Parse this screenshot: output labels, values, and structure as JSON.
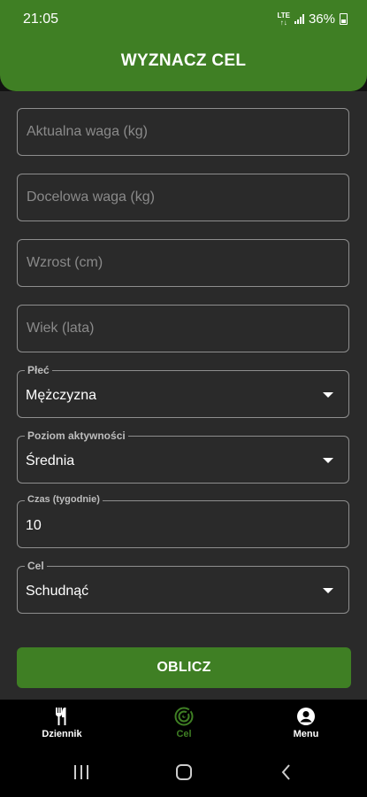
{
  "status_bar": {
    "time": "21:05",
    "battery": "36%",
    "network": "LTE"
  },
  "header": {
    "title": "WYZNACZ CEL"
  },
  "form": {
    "current_weight": {
      "placeholder": "Aktualna waga (kg)",
      "value": ""
    },
    "target_weight": {
      "placeholder": "Docelowa waga (kg)",
      "value": ""
    },
    "height": {
      "placeholder": "Wzrost (cm)",
      "value": ""
    },
    "age": {
      "placeholder": "Wiek (lata)",
      "value": ""
    },
    "sex": {
      "label": "Płeć",
      "value": "Mężczyzna"
    },
    "activity": {
      "label": "Poziom aktywności",
      "value": "Średnia"
    },
    "duration": {
      "label": "Czas (tygodnie)",
      "value": "10"
    },
    "goal": {
      "label": "Cel",
      "value": "Schudnąć"
    }
  },
  "calculate_button": {
    "label": "OBLICZ"
  },
  "bottom_nav": {
    "items": [
      {
        "label": "Dziennik",
        "icon": "fork-knife-icon"
      },
      {
        "label": "Cel",
        "icon": "target-icon",
        "active": true
      },
      {
        "label": "Menu",
        "icon": "account-icon"
      }
    ]
  },
  "colors": {
    "accent": "#3f7f24",
    "background": "#2a2a2a",
    "nav_background": "#000000"
  }
}
